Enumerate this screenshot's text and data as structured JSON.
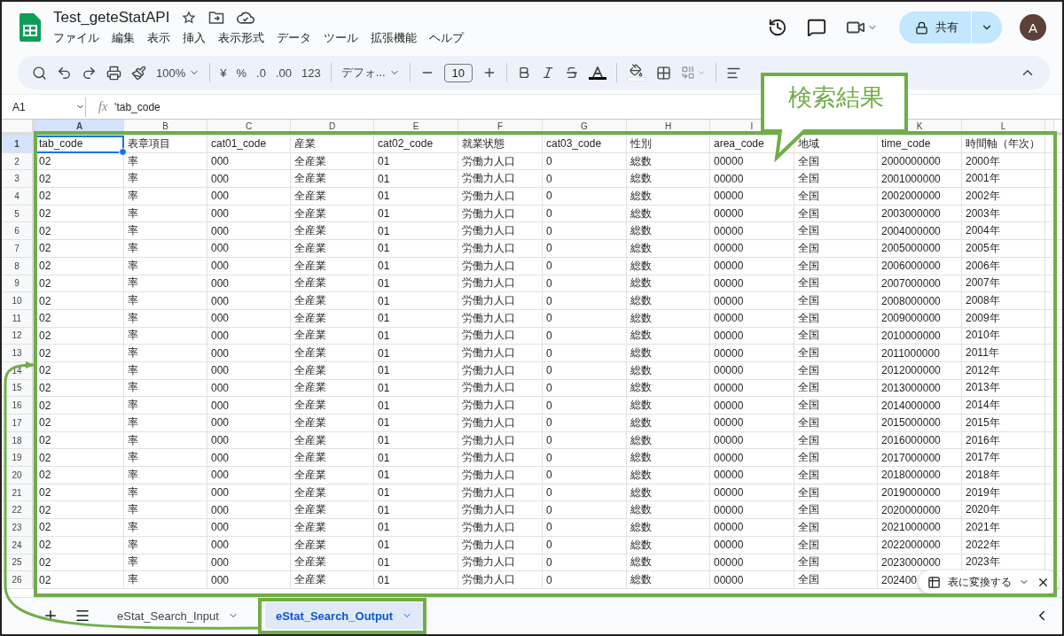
{
  "title": "Test_geteStatAPI",
  "menu": [
    "ファイル",
    "編集",
    "表示",
    "挿入",
    "表示形式",
    "データ",
    "ツール",
    "拡張機能",
    "ヘルプ"
  ],
  "share_button": "共有",
  "avatar": "A",
  "toolbar": {
    "zoom": "100%",
    "currency": "¥",
    "percent": "%",
    "decrease_decimal": ".0",
    "increase_decimal": ".00",
    "number_format": "123",
    "font": "デフォ...",
    "font_size": "10"
  },
  "formula_bar": {
    "name_box": "A1",
    "fx_label": "fx",
    "formula": "'tab_code"
  },
  "sheet": {
    "columns": [
      {
        "letter": "A",
        "selected": true
      },
      {
        "letter": "B",
        "selected": false
      },
      {
        "letter": "C",
        "selected": false
      },
      {
        "letter": "D",
        "selected": false
      },
      {
        "letter": "E",
        "selected": false
      },
      {
        "letter": "F",
        "selected": false
      },
      {
        "letter": "G",
        "selected": false
      },
      {
        "letter": "H",
        "selected": false
      },
      {
        "letter": "I",
        "selected": false
      },
      {},
      {
        "letter": "K",
        "selected": false
      },
      {
        "letter": "L",
        "selected": false
      }
    ],
    "rows": [
      {
        "number": "1",
        "selected": true,
        "cells": [
          "tab_code",
          "表章項目",
          "cat01_code",
          "産業",
          "cat02_code",
          "就業状態",
          "cat03_code",
          "性別",
          "area_code",
          "地域",
          "time_code",
          "時間軸（年次）"
        ]
      },
      {
        "number": "2",
        "selected": false,
        "cells": [
          "02",
          "率",
          "000",
          "全産業",
          "01",
          "労働力人口",
          "0",
          "総数",
          "00000",
          "全国",
          "2000000000",
          "2000年"
        ]
      },
      {
        "number": "3",
        "selected": false,
        "cells": [
          "02",
          "率",
          "000",
          "全産業",
          "01",
          "労働力人口",
          "0",
          "総数",
          "00000",
          "全国",
          "2001000000",
          "2001年"
        ]
      },
      {
        "number": "4",
        "selected": false,
        "cells": [
          "02",
          "率",
          "000",
          "全産業",
          "01",
          "労働力人口",
          "0",
          "総数",
          "00000",
          "全国",
          "2002000000",
          "2002年"
        ]
      },
      {
        "number": "5",
        "selected": false,
        "cells": [
          "02",
          "率",
          "000",
          "全産業",
          "01",
          "労働力人口",
          "0",
          "総数",
          "00000",
          "全国",
          "2003000000",
          "2003年"
        ]
      },
      {
        "number": "6",
        "selected": false,
        "cells": [
          "02",
          "率",
          "000",
          "全産業",
          "01",
          "労働力人口",
          "0",
          "総数",
          "00000",
          "全国",
          "2004000000",
          "2004年"
        ]
      },
      {
        "number": "7",
        "selected": false,
        "cells": [
          "02",
          "率",
          "000",
          "全産業",
          "01",
          "労働力人口",
          "0",
          "総数",
          "00000",
          "全国",
          "2005000000",
          "2005年"
        ]
      },
      {
        "number": "8",
        "selected": false,
        "cells": [
          "02",
          "率",
          "000",
          "全産業",
          "01",
          "労働力人口",
          "0",
          "総数",
          "00000",
          "全国",
          "2006000000",
          "2006年"
        ]
      },
      {
        "number": "9",
        "selected": false,
        "cells": [
          "02",
          "率",
          "000",
          "全産業",
          "01",
          "労働力人口",
          "0",
          "総数",
          "00000",
          "全国",
          "2007000000",
          "2007年"
        ]
      },
      {
        "number": "10",
        "selected": false,
        "cells": [
          "02",
          "率",
          "000",
          "全産業",
          "01",
          "労働力人口",
          "0",
          "総数",
          "00000",
          "全国",
          "2008000000",
          "2008年"
        ]
      },
      {
        "number": "11",
        "selected": false,
        "cells": [
          "02",
          "率",
          "000",
          "全産業",
          "01",
          "労働力人口",
          "0",
          "総数",
          "00000",
          "全国",
          "2009000000",
          "2009年"
        ]
      },
      {
        "number": "12",
        "selected": false,
        "cells": [
          "02",
          "率",
          "000",
          "全産業",
          "01",
          "労働力人口",
          "0",
          "総数",
          "00000",
          "全国",
          "2010000000",
          "2010年"
        ]
      },
      {
        "number": "13",
        "selected": false,
        "cells": [
          "02",
          "率",
          "000",
          "全産業",
          "01",
          "労働力人口",
          "0",
          "総数",
          "00000",
          "全国",
          "2011000000",
          "2011年"
        ]
      },
      {
        "number": "14",
        "selected": false,
        "cells": [
          "02",
          "率",
          "000",
          "全産業",
          "01",
          "労働力人口",
          "0",
          "総数",
          "00000",
          "全国",
          "2012000000",
          "2012年"
        ]
      },
      {
        "number": "15",
        "selected": false,
        "cells": [
          "02",
          "率",
          "000",
          "全産業",
          "01",
          "労働力人口",
          "0",
          "総数",
          "00000",
          "全国",
          "2013000000",
          "2013年"
        ]
      },
      {
        "number": "16",
        "selected": false,
        "cells": [
          "02",
          "率",
          "000",
          "全産業",
          "01",
          "労働力人口",
          "0",
          "総数",
          "00000",
          "全国",
          "2014000000",
          "2014年"
        ]
      },
      {
        "number": "17",
        "selected": false,
        "cells": [
          "02",
          "率",
          "000",
          "全産業",
          "01",
          "労働力人口",
          "0",
          "総数",
          "00000",
          "全国",
          "2015000000",
          "2015年"
        ]
      },
      {
        "number": "18",
        "selected": false,
        "cells": [
          "02",
          "率",
          "000",
          "全産業",
          "01",
          "労働力人口",
          "0",
          "総数",
          "00000",
          "全国",
          "2016000000",
          "2016年"
        ]
      },
      {
        "number": "19",
        "selected": false,
        "cells": [
          "02",
          "率",
          "000",
          "全産業",
          "01",
          "労働力人口",
          "0",
          "総数",
          "00000",
          "全国",
          "2017000000",
          "2017年"
        ]
      },
      {
        "number": "20",
        "selected": false,
        "cells": [
          "02",
          "率",
          "000",
          "全産業",
          "01",
          "労働力人口",
          "0",
          "総数",
          "00000",
          "全国",
          "2018000000",
          "2018年"
        ]
      },
      {
        "number": "21",
        "selected": false,
        "cells": [
          "02",
          "率",
          "000",
          "全産業",
          "01",
          "労働力人口",
          "0",
          "総数",
          "00000",
          "全国",
          "2019000000",
          "2019年"
        ]
      },
      {
        "number": "22",
        "selected": false,
        "cells": [
          "02",
          "率",
          "000",
          "全産業",
          "01",
          "労働力人口",
          "0",
          "総数",
          "00000",
          "全国",
          "2020000000",
          "2020年"
        ]
      },
      {
        "number": "23",
        "selected": false,
        "cells": [
          "02",
          "率",
          "000",
          "全産業",
          "01",
          "労働力人口",
          "0",
          "総数",
          "00000",
          "全国",
          "2021000000",
          "2021年"
        ]
      },
      {
        "number": "24",
        "selected": false,
        "cells": [
          "02",
          "率",
          "000",
          "全産業",
          "01",
          "労働力人口",
          "0",
          "総数",
          "00000",
          "全国",
          "2022000000",
          "2022年"
        ]
      },
      {
        "number": "25",
        "selected": false,
        "cells": [
          "02",
          "率",
          "000",
          "全産業",
          "01",
          "労働力人口",
          "0",
          "総数",
          "00000",
          "全国",
          "2023000000",
          "2023年"
        ]
      },
      {
        "number": "26",
        "selected": false,
        "cells": [
          "02",
          "率",
          "000",
          "全産業",
          "01",
          "労働力人口",
          "0",
          "総数",
          "00000",
          "全国",
          "202400"
        ]
      }
    ]
  },
  "convert_popup": {
    "label": "表に変換する"
  },
  "sheet_tabs": [
    {
      "label": "eStat_Search_Input",
      "selected": false
    },
    {
      "label": "eStat_Search_Output",
      "selected": true
    }
  ],
  "callout": {
    "label": "検索結果"
  }
}
